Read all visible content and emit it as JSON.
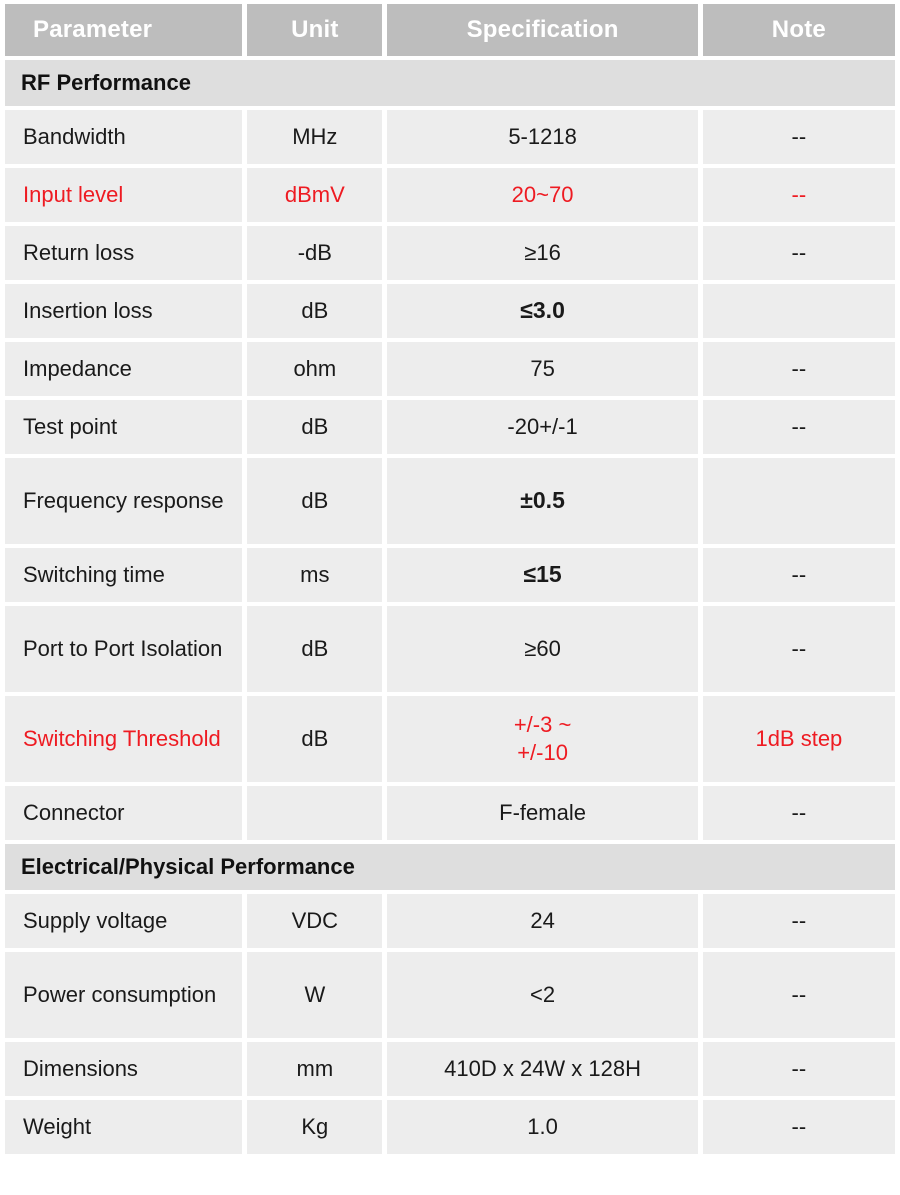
{
  "table": {
    "columns": [
      {
        "key": "parameter",
        "label": "Parameter"
      },
      {
        "key": "unit",
        "label": "Unit"
      },
      {
        "key": "specification",
        "label": "Specification"
      },
      {
        "key": "note",
        "label": "Note"
      }
    ],
    "colors": {
      "header_bg": "#bdbdbd",
      "header_text": "#ffffff",
      "section_bg": "#dedede",
      "row_bg": "#ededed",
      "text": "#1a1a1a",
      "highlight_red": "#ee1b22",
      "page_bg": "#ffffff"
    },
    "sections": [
      {
        "title": "RF Performance",
        "rows": [
          {
            "parameter": "Bandwidth",
            "unit": "MHz",
            "specification": "5-1218",
            "note": "--"
          },
          {
            "parameter": "Input level",
            "unit": "dBmV",
            "specification": "20~70",
            "note": "--"
          },
          {
            "parameter": "Return loss",
            "unit": "-dB",
            "specification": "≥16",
            "note": "--"
          },
          {
            "parameter": "Insertion loss",
            "unit": "dB",
            "specification": "≤3.0",
            "note": ""
          },
          {
            "parameter": "Impedance",
            "unit": "ohm",
            "specification": "75",
            "note": "--"
          },
          {
            "parameter": "Test point",
            "unit": "dB",
            "specification": "-20+/-1",
            "note": "--"
          },
          {
            "parameter": "Frequency response",
            "unit": "dB",
            "specification": "±0.5",
            "note": ""
          },
          {
            "parameter": "Switching time",
            "unit": "ms",
            "specification": "≤15",
            "note": "--"
          },
          {
            "parameter": "Port to Port Isolation",
            "unit": "dB",
            "specification": "≥60",
            "note": "--"
          },
          {
            "parameter": "Switching Threshold",
            "unit": "dB",
            "specification": "+/-3 ~\n+/-10",
            "note": "1dB step"
          },
          {
            "parameter": "Connector",
            "unit": "",
            "specification": "F-female",
            "note": "--"
          }
        ]
      },
      {
        "title": "Electrical/Physical Performance",
        "rows": [
          {
            "parameter": "Supply voltage",
            "unit": "VDC",
            "specification": "24",
            "note": "--"
          },
          {
            "parameter": "Power consumption",
            "unit": "W",
            "specification": "<2",
            "note": "--"
          },
          {
            "parameter": "Dimensions",
            "unit": "mm",
            "specification": "410D x 24W x 128H",
            "note": "--"
          },
          {
            "parameter": "Weight",
            "unit": "Kg",
            "specification": "1.0",
            "note": "--"
          }
        ]
      }
    ]
  }
}
